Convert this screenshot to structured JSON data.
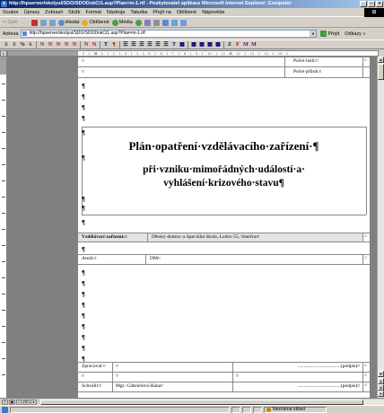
{
  "window": {
    "title": "http://hpserver/skolyul/SDO/SDODokCt1.asp?Plan=m-1.rtf - Poskytovatel aplikace Microsoft Internet Explorer: Computer",
    "buttons": [
      "_",
      "□",
      "×"
    ]
  },
  "menu": {
    "items": [
      "Soubor",
      "Úpravy",
      "Zobrazit",
      "Složk",
      "Formát",
      "Nástroje",
      "Tabulka",
      "Přejít na",
      "Oblíbené",
      "Nápověda"
    ]
  },
  "toolbar": {
    "back": "Zpět",
    "search": "Hledat",
    "favorites": "Oblíbené",
    "media": "Média"
  },
  "address": {
    "label": "Adresa",
    "url": "http://hpserver/skolyul/SDO/SDODokCt1.asp?Plan=m-1.rtf",
    "go": "Přejít",
    "links": "Odkazy »"
  },
  "ruler": {
    "marks": "· 2 · 1 · ⊠ · 1 · 1 · 2 · 1 · 3 · 1 · 4 · 1 · 5 · 1 · 6 · 1 · 7 · 1 · 8 · 1 · 9 · 1 · 10 · 1 · 11 · ⊠ · 12 · 1 · 13 · 1 · 14 · 1 · 15 · 1 ·"
  },
  "document": {
    "pocet_listu": "Počet·listů:¤",
    "pocet_priloh": "Počet·příloh:¤",
    "title1": "Plán·opatření·vzdělávacího·zařízení·¶",
    "title2": "při·vzniku·mimořádných·událostí·a·",
    "title3": "vyhlášení·krizového·stavu¶",
    "zarizeni_label": "Vzdělávací·zařízení:¤",
    "zarizeni_value": "Dětský·domov·a·Speciální·škola,·Ledce·55,·Smečno¤",
    "areal_label": "Areál:¤",
    "areal_value": "DM¤",
    "zpracoval_label": "Zpracoval:¤",
    "schvalil_label": "Schválil:¤",
    "schvalil_value": "Mgr.·Gabrielová·Hana¤",
    "podpis1": "...................................(podpis)¤",
    "podpis2": "...................................(podpis)¤",
    "cell_mark": "¤",
    "para_mark": "¶"
  },
  "status": {
    "zone": "Neznámá oblast"
  }
}
